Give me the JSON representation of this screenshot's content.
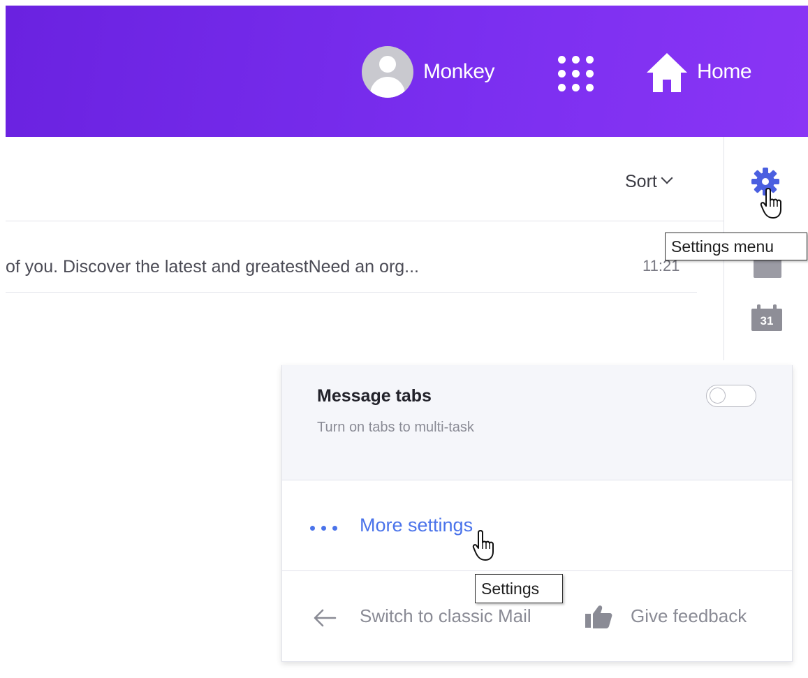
{
  "header": {
    "user_name": "Monkey",
    "home_label": "Home",
    "icons": {
      "avatar": "avatar-icon",
      "apps": "apps-grid-icon",
      "home": "home-icon"
    },
    "gradient_start": "#6a22e0",
    "gradient_end": "#8a35f5"
  },
  "toolbar": {
    "sort_label": "Sort"
  },
  "messages": [
    {
      "snippet": "of you. Discover the latest and greatestNeed an org...",
      "time": "11:21"
    }
  ],
  "rail": {
    "settings_icon": "gear-icon",
    "contacts_icon": "contacts-icon",
    "calendar_icon": "calendar-icon",
    "calendar_day": "31",
    "accent": "#4a73ea"
  },
  "tooltips": {
    "settings_menu": "Settings menu",
    "settings": "Settings"
  },
  "settings_panel": {
    "message_tabs": {
      "title": "Message tabs",
      "description": "Turn on tabs to multi-task",
      "enabled": false
    },
    "more_settings_label": "More settings",
    "switch_classic_label": "Switch to classic Mail",
    "give_feedback_label": "Give feedback"
  }
}
